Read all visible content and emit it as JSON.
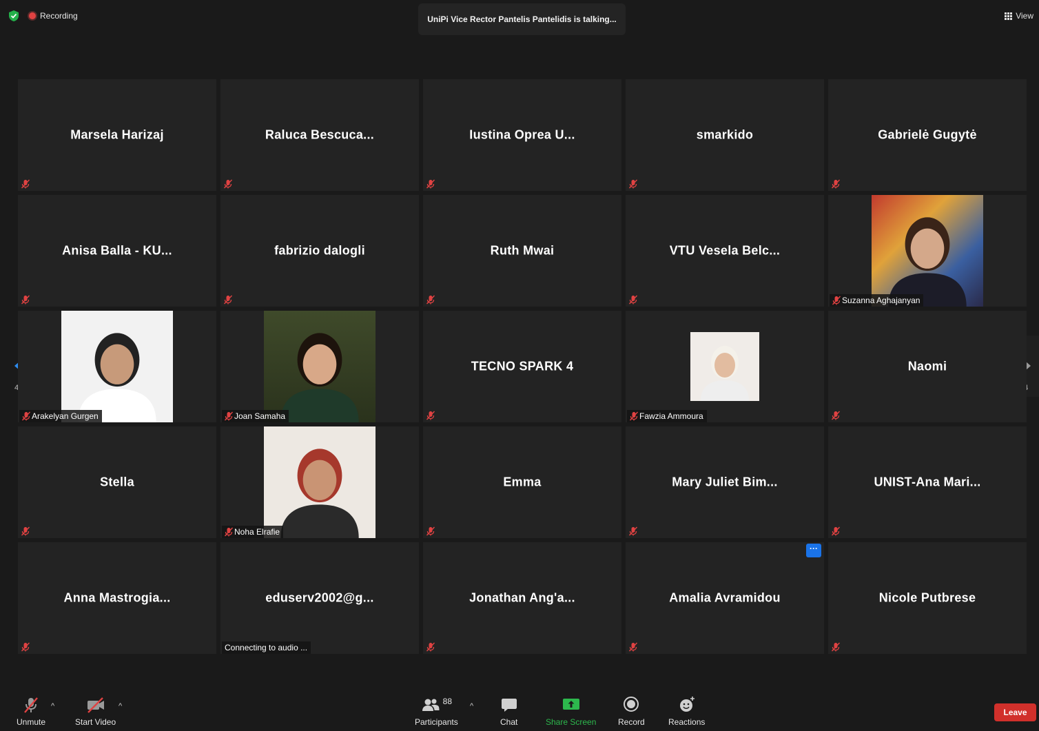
{
  "header": {
    "recording_label": "Recording",
    "talking_text": "UniPi Vice Rector Pantelis Pantelidis is talking...",
    "view_label": "View"
  },
  "pagination": {
    "left": "4/4",
    "right": "4/4"
  },
  "tiles": [
    {
      "name": "Marsela Harizaj"
    },
    {
      "name": "Raluca Bescuca..."
    },
    {
      "name": "Iustina Oprea U..."
    },
    {
      "name": "smarkido"
    },
    {
      "name": "Gabrielė Gugytė"
    },
    {
      "name": "Anisa Balla - KU..."
    },
    {
      "name": "fabrizio dalogli"
    },
    {
      "name": "Ruth Mwai"
    },
    {
      "name": "VTU Vesela Belc..."
    },
    {
      "label": "Suzanna Aghajanyan"
    },
    {
      "label": "Arakelyan Gurgen"
    },
    {
      "label": "Joan Samaha"
    },
    {
      "name": "TECNO SPARK 4"
    },
    {
      "label": "Fawzia Ammoura"
    },
    {
      "name": "Naomi"
    },
    {
      "name": "Stella"
    },
    {
      "label": "Noha Elrafie"
    },
    {
      "name": "Emma"
    },
    {
      "name": "Mary Juliet Bim..."
    },
    {
      "name": "UNIST-Ana Mari..."
    },
    {
      "name": "Anna Mastrogia..."
    },
    {
      "name": "eduserv2002@g...",
      "status": "Connecting to audio ..."
    },
    {
      "name": "Jonathan Ang'a..."
    },
    {
      "name": "Amalia Avramidou"
    },
    {
      "name": "Nicole Putbrese"
    }
  ],
  "toolbar": {
    "unmute": "Unmute",
    "start_video": "Start Video",
    "participants_count": "88",
    "participants": "Participants",
    "chat": "Chat",
    "share_screen": "Share Screen",
    "record": "Record",
    "reactions": "Reactions",
    "leave": "Leave"
  },
  "colors": {
    "share_green": "#2db84d",
    "leave_red": "#d1302b",
    "mute_red": "#e04242"
  }
}
